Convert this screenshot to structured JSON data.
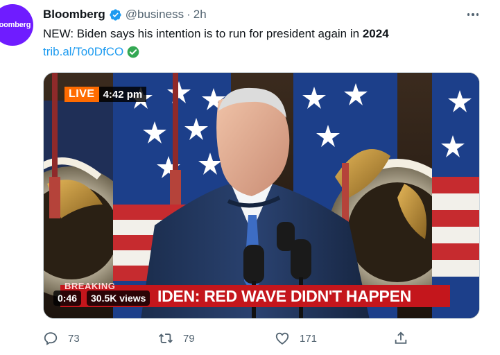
{
  "author": {
    "name": "Bloomberg",
    "handle": "@business",
    "separator": "·",
    "time": "2h",
    "avatar_text": "loomberg",
    "brand_color": "#6f1cff",
    "verified_icon": "verified-badge-icon"
  },
  "tweet": {
    "text_prefix": "NEW: Biden says his intention is to run for president again in ",
    "text_bold": "2024",
    "link": "trib.al/To0DfCO",
    "link_color": "#1d9bf0"
  },
  "media": {
    "live_label": "LIVE",
    "clock": "4:42 pm",
    "breaking_label": "BREAKING",
    "headline": "IDEN: RED WAVE DIDN'T HAPPEN",
    "duration": "0:46",
    "views": "30.5K views",
    "breaking_color": "#c4161c",
    "live_color": "#ff6b00"
  },
  "actions": {
    "replies": "73",
    "retweets": "79",
    "likes": "171",
    "reply_icon": "reply-icon",
    "retweet_icon": "retweet-icon",
    "like_icon": "heart-icon",
    "share_icon": "share-icon"
  }
}
